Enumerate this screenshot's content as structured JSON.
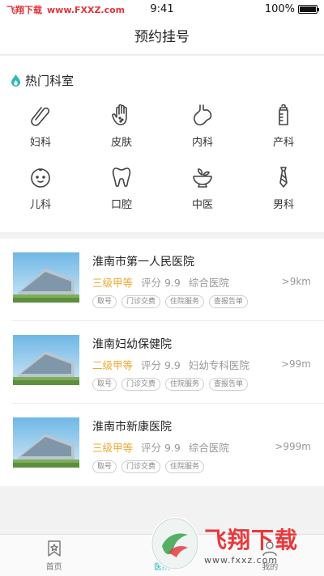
{
  "status_bar": {
    "watermark_left": "飞翔下载",
    "watermark_url": "www.FXXZ.com",
    "time": "9:41",
    "battery": "100%",
    "battery_level": 1.0
  },
  "nav": {
    "title": "预约挂号"
  },
  "departments": {
    "header": "热门科室",
    "items": [
      {
        "label": "妇科",
        "icon": "paperclip-icon"
      },
      {
        "label": "皮肤",
        "icon": "hand-icon"
      },
      {
        "label": "内科",
        "icon": "stomach-icon"
      },
      {
        "label": "产科",
        "icon": "baby-bottle-icon"
      },
      {
        "label": "儿科",
        "icon": "baby-face-icon"
      },
      {
        "label": "口腔",
        "icon": "tooth-icon"
      },
      {
        "label": "中医",
        "icon": "mortar-icon"
      },
      {
        "label": "男科",
        "icon": "necktie-icon"
      }
    ]
  },
  "hospitals": [
    {
      "name": "淮南市第一人民医院",
      "grade": "三级甲等",
      "rating": "评分 9.9",
      "type": "综合医院",
      "distance": ">9km",
      "tags": [
        "取号",
        "门诊交费",
        "住院服务",
        "查报告单"
      ]
    },
    {
      "name": "淮南妇幼保健院",
      "grade": "二级甲等",
      "rating": "评分 9.9",
      "type": "妇幼专科医院",
      "distance": ">99m",
      "tags": [
        "取号",
        "门诊交费",
        "住院服务",
        "查报告单"
      ]
    },
    {
      "name": "淮南市新康医院",
      "grade": "三级甲等",
      "rating": "评分 9.9",
      "type": "综合医院",
      "distance": ">999m",
      "tags": [
        "取号",
        "门诊交费",
        "住院服务"
      ]
    }
  ],
  "tab_bar": {
    "tabs": [
      {
        "label": "首页",
        "icon": "home-icon"
      },
      {
        "label": "医院",
        "icon": "hospital-icon"
      },
      {
        "label": "我的",
        "icon": "person-icon"
      }
    ]
  },
  "watermark": {
    "text": "飞翔下载",
    "url": "www.fxxz.com"
  },
  "colors": {
    "accent": "#2fb9b5",
    "grade": "#f0a830",
    "watermark": "#e8393e"
  }
}
